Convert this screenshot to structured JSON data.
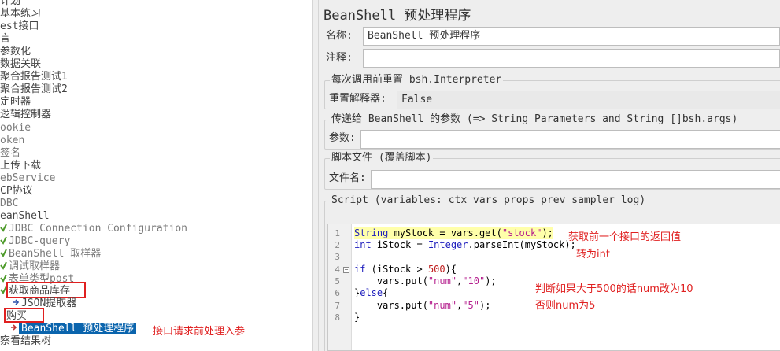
{
  "tree": {
    "items": [
      {
        "label": "计划",
        "style": "normal"
      },
      {
        "label": "基本练习",
        "style": "normal"
      },
      {
        "label": "est接口",
        "style": "normal"
      },
      {
        "label": "言",
        "style": "normal"
      },
      {
        "label": "参数化",
        "style": "normal"
      },
      {
        "label": "数据关联",
        "style": "normal"
      },
      {
        "label": "聚合报告测试1",
        "style": "normal"
      },
      {
        "label": "聚合报告测试2",
        "style": "normal"
      },
      {
        "label": "定时器",
        "style": "normal"
      },
      {
        "label": "逻辑控制器",
        "style": "normal"
      },
      {
        "label": "ookie",
        "style": "normal"
      },
      {
        "label": "oken",
        "style": "normal"
      },
      {
        "label": "签名",
        "style": "normal"
      },
      {
        "label": "上传下载",
        "style": "normal"
      },
      {
        "label": "ebService",
        "style": "normal"
      },
      {
        "label": "CP协议",
        "style": "normal"
      },
      {
        "label": "DBC",
        "style": "normal"
      },
      {
        "label": "eanShell",
        "style": "normal"
      },
      {
        "label": "JDBC Connection Configuration",
        "style": "gray"
      },
      {
        "label": "JDBC-query",
        "style": "gray"
      },
      {
        "label": "BeanShell 取样器",
        "style": "gray"
      },
      {
        "label": "调试取样器",
        "style": "gray"
      },
      {
        "label": "表单类型post",
        "style": "gray"
      },
      {
        "label": "获取商品库存",
        "style": "normal"
      },
      {
        "label": "JSON提取器",
        "style": "normal"
      },
      {
        "label": "购买",
        "style": "normal"
      },
      {
        "label": "BeanShell 预处理程序",
        "style": "selected"
      },
      {
        "label": "察看结果树",
        "style": "normal"
      }
    ],
    "annotation": "接口请求前处理入参"
  },
  "panel": {
    "title": "BeanShell 预处理程序",
    "name_label": "名称:",
    "name_value": "BeanShell 预处理程序",
    "comment_label": "注释:",
    "comment_value": "",
    "reset_group_title": "每次调用前重置 bsh.Interpreter",
    "reset_label": "重置解释器:",
    "reset_value": "False",
    "params_group_title": "传递给 BeanShell 的参数 (=> String Parameters and String []bsh.args)",
    "params_label": "参数:",
    "params_value": "",
    "file_group_title": "脚本文件 (覆盖脚本)",
    "file_label": "文件名:",
    "file_value": "",
    "script_group_title": "Script (variables: ctx vars props prev sampler log)"
  },
  "script": {
    "line_numbers": [
      "1",
      "2",
      "3",
      "4",
      "5",
      "6",
      "7",
      "8"
    ],
    "annotations": {
      "a1": "获取前一个接口的返回值",
      "a2": "转为int",
      "a3": "判断如果大于500的话num改为10",
      "a4": "否则num为5"
    }
  },
  "colors": {
    "selection": "#0a64ad",
    "annotation": "#e02020",
    "keyword": "#1d1dbd",
    "string": "#b5208e",
    "highlight_line": "#ffffaa"
  }
}
